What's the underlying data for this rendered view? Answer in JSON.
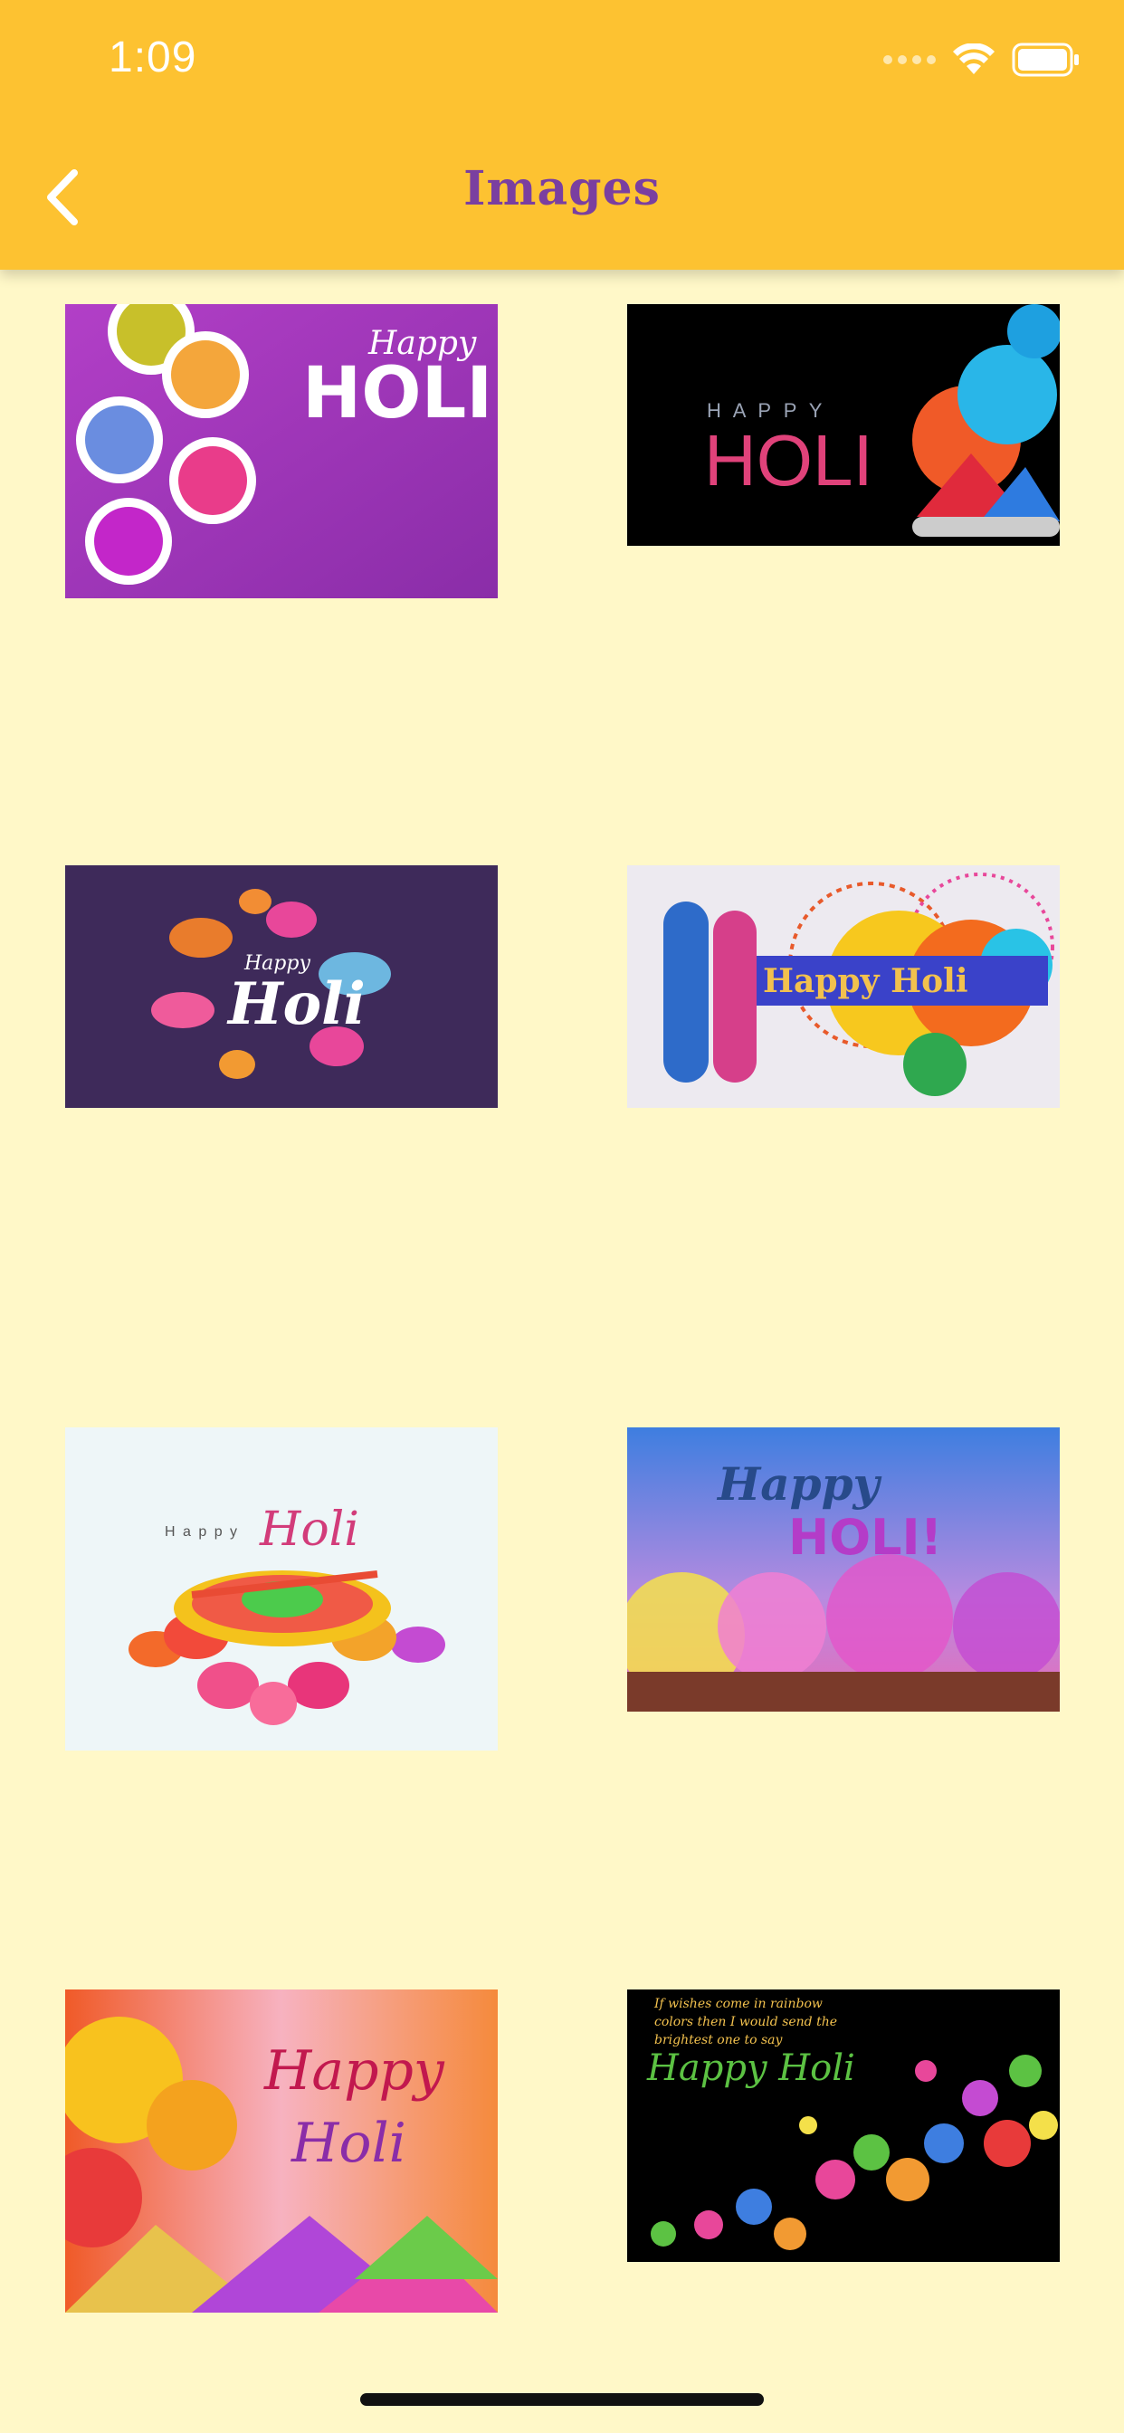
{
  "status_bar": {
    "time": "1:09"
  },
  "nav": {
    "title": "Images"
  },
  "images": [
    {
      "kind": "powder-bowls",
      "line1": "Happy",
      "line2": "HOLI"
    },
    {
      "kind": "black-splash",
      "line1": "H A P P Y",
      "line2": "HOLI"
    },
    {
      "kind": "paisley",
      "line1": "Happy",
      "line2": "Holi"
    },
    {
      "kind": "krishna",
      "line1": "Happy Holi"
    },
    {
      "kind": "rangoli",
      "line1": "H a p p y",
      "line2": "Holi"
    },
    {
      "kind": "crowd",
      "line1": "Happy",
      "line2": "HOLI!"
    },
    {
      "kind": "flowers",
      "line1": "Happy",
      "line2": "Holi"
    },
    {
      "kind": "balloons",
      "line1": "If wishes come in rainbow",
      "line2": "colors then I would send the",
      "line3": "brightest one to say",
      "line4": "Happy Holi"
    }
  ],
  "colors": {
    "header": "#FDC231",
    "background": "#FFF8C8",
    "title": "#7A3FA0"
  }
}
